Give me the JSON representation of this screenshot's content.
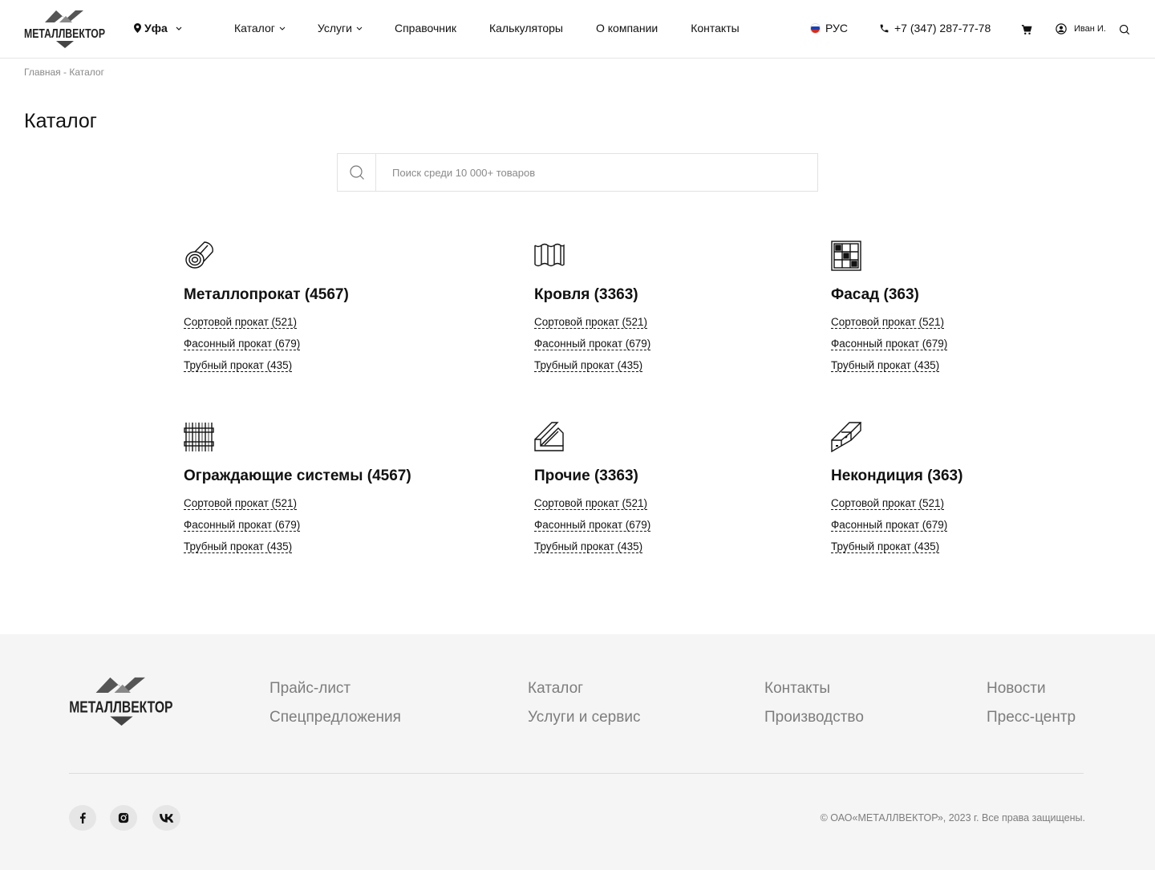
{
  "header": {
    "logo_text": "МЕТАЛЛВЕКТОР",
    "city": "Уфа",
    "nav": [
      {
        "label": "Каталог",
        "dropdown": true
      },
      {
        "label": "Услуги",
        "dropdown": true
      },
      {
        "label": "Справочник",
        "dropdown": false
      },
      {
        "label": "Калькуляторы",
        "dropdown": false
      },
      {
        "label": "О компании",
        "dropdown": false
      },
      {
        "label": "Контакты",
        "dropdown": false
      }
    ],
    "language": "РУС",
    "phone": "+7 (347) 287-77-78",
    "user_name": "Иван И."
  },
  "breadcrumb": [
    "Главная",
    "Каталог"
  ],
  "breadcrumb_separator": " - ",
  "page_title": "Каталог",
  "search": {
    "placeholder": "Поиск среди 10 000+ товаров",
    "value": ""
  },
  "categories": [
    {
      "title": "Металлопрокат (4567)",
      "icon": "pipe-rolls-icon",
      "links": [
        "Сортовой прокат (521)",
        "Фасонный прокат (679)",
        "Трубный прокат (435)"
      ]
    },
    {
      "title": "Кровля (3363)",
      "icon": "roof-sheet-icon",
      "links": [
        "Сортовой прокат (521)",
        "Фасонный прокат (679)",
        "Трубный прокат (435)"
      ]
    },
    {
      "title": "Фасад (363)",
      "icon": "facade-panel-icon",
      "links": [
        "Сортовой прокат (521)",
        "Фасонный прокат (679)",
        "Трубный прокат (435)"
      ]
    },
    {
      "title": "Ограждающие системы (4567)",
      "icon": "fence-icon",
      "links": [
        "Сортовой прокат (521)",
        "Фасонный прокат (679)",
        "Трубный прокат (435)"
      ]
    },
    {
      "title": "Прочие (3363)",
      "icon": "angle-profile-icon",
      "links": [
        "Сортовой прокат (521)",
        "Фасонный прокат (679)",
        "Трубный прокат (435)"
      ]
    },
    {
      "title": "Некондиция (363)",
      "icon": "i-beam-icon",
      "links": [
        "Сортовой прокат (521)",
        "Фасонный прокат (679)",
        "Трубный прокат (435)"
      ]
    }
  ],
  "footer": {
    "logo_text": "МЕТАЛЛВЕКТОР",
    "columns": [
      [
        "Прайс-лист",
        "Спецпредложения"
      ],
      [
        "Каталог",
        "Услуги и сервис"
      ],
      [
        "Контакты",
        "Производство"
      ],
      [
        "Новости",
        "Пресс-центр"
      ]
    ],
    "social": [
      "facebook-icon",
      "instagram-icon",
      "vk-icon"
    ],
    "copyright": "© ОАО«МЕТАЛЛВЕКТОР», 2023 г. Все права защищены."
  },
  "colors": {
    "text": "#111111",
    "muted": "#7d7d7d",
    "footer_bg": "#f5f5f5",
    "border": "#e2e2e2"
  }
}
